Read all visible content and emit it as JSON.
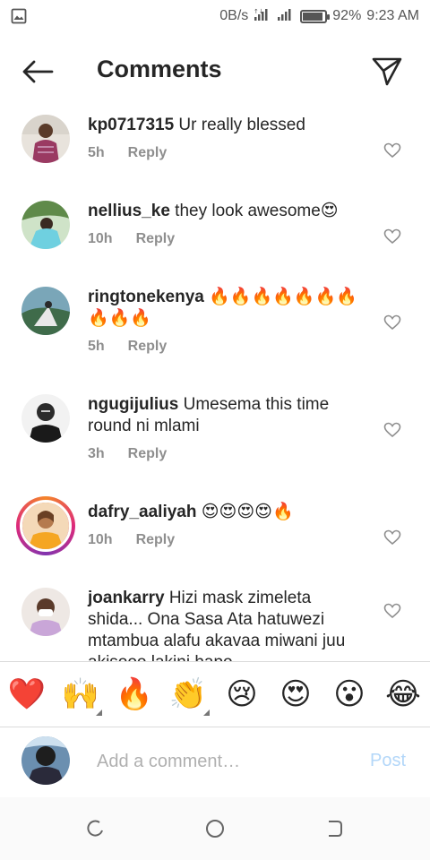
{
  "status_bar": {
    "speed": "0B/s",
    "battery_percent": "92%",
    "battery_level": 0.92,
    "time": "9:23 AM",
    "icons": [
      "image-icon",
      "signal-icon",
      "signal-icon",
      "battery-icon"
    ]
  },
  "header": {
    "title": "Comments",
    "back_icon": "back-arrow-icon",
    "share_icon": "send-icon"
  },
  "comments": [
    {
      "username": "kp0717315",
      "text": " Ur really blessed",
      "time": "5h",
      "reply": "Reply"
    },
    {
      "username": "nellius_ke",
      "text": " they look awesome😍",
      "time": "10h",
      "reply": "Reply"
    },
    {
      "username": "ringtonekenya",
      "text": " 🔥🔥🔥🔥🔥🔥🔥🔥🔥🔥",
      "time": "5h",
      "reply": "Reply"
    },
    {
      "username": "ngugijulius",
      "text": " Umesema this time round ni mlami",
      "time": "3h",
      "reply": "Reply"
    },
    {
      "username": "dafry_aaliyah",
      "text": " 😍😍😍😍🔥",
      "time": "10h",
      "reply": "Reply"
    },
    {
      "username": "joankarry",
      "text": " Hizi mask zimeleta shida... Ona Sasa Ata hatuwezi mtambua alafu akavaa miwani juu akisooo lakini hapo"
    }
  ],
  "quick_reactions": [
    "❤️",
    "🙌",
    "🔥",
    "👏",
    "😢",
    "😍",
    "😮",
    "😂"
  ],
  "input": {
    "placeholder": "Add a comment…",
    "post_label": "Post"
  },
  "colors": {
    "text": "#262626",
    "muted": "#8e8e8e",
    "post_disabled": "#b3d7f9",
    "divider": "#dbdbdb"
  }
}
